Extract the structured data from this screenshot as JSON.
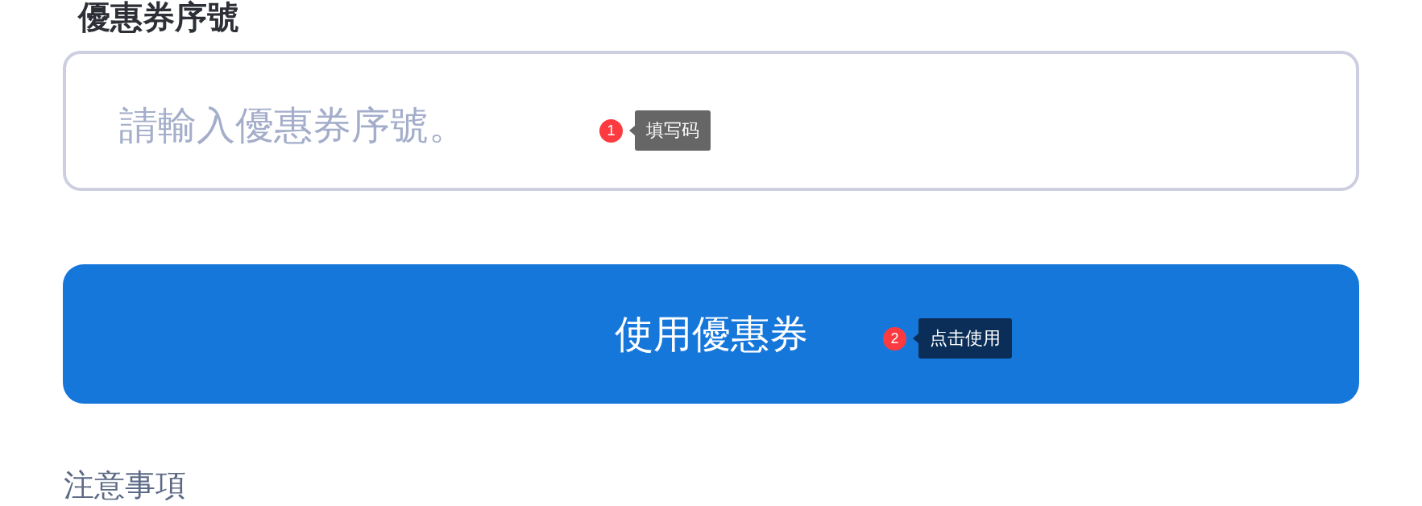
{
  "coupon_code": {
    "label": "優惠券序號",
    "placeholder": "請輸入優惠券序號。",
    "callout": {
      "number": "1",
      "text": "填写码",
      "color": "#666666"
    }
  },
  "use_button": {
    "label": "使用優惠券",
    "callout": {
      "number": "2",
      "text": "点击使用",
      "color": "#0b2e59"
    }
  },
  "notes": {
    "heading": "注意事項"
  }
}
